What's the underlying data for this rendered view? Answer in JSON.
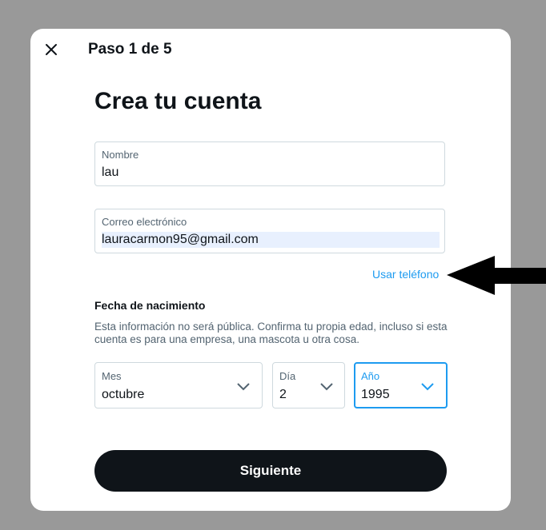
{
  "header": {
    "step_label": "Paso 1 de 5"
  },
  "title": "Crea tu cuenta",
  "name_field": {
    "label": "Nombre",
    "value": "lau"
  },
  "email_field": {
    "label": "Correo electrónico",
    "value": "lauracarmon95@gmail.com"
  },
  "use_phone_link": "Usar teléfono",
  "birthdate": {
    "heading": "Fecha de nacimiento",
    "description": "Esta información no será pública. Confirma tu propia edad, incluso si esta cuenta es para una empresa, una mascota u otra cosa.",
    "month": {
      "label": "Mes",
      "value": "octubre"
    },
    "day": {
      "label": "Día",
      "value": "2"
    },
    "year": {
      "label": "Año",
      "value": "1995"
    }
  },
  "next_button": "Siguiente",
  "icons": {
    "close": "close-icon",
    "chevron": "chevron-down-icon",
    "annotation": "arrow-left-icon"
  },
  "colors": {
    "backdrop": "#999999",
    "modal": "#ffffff",
    "text": "#0f1419",
    "muted": "#536471",
    "accent": "#1d9bf0",
    "border": "#cfd9de",
    "autofill": "#e8f0fe",
    "button": "#0f1419",
    "annotation_arrow": "#000000"
  }
}
